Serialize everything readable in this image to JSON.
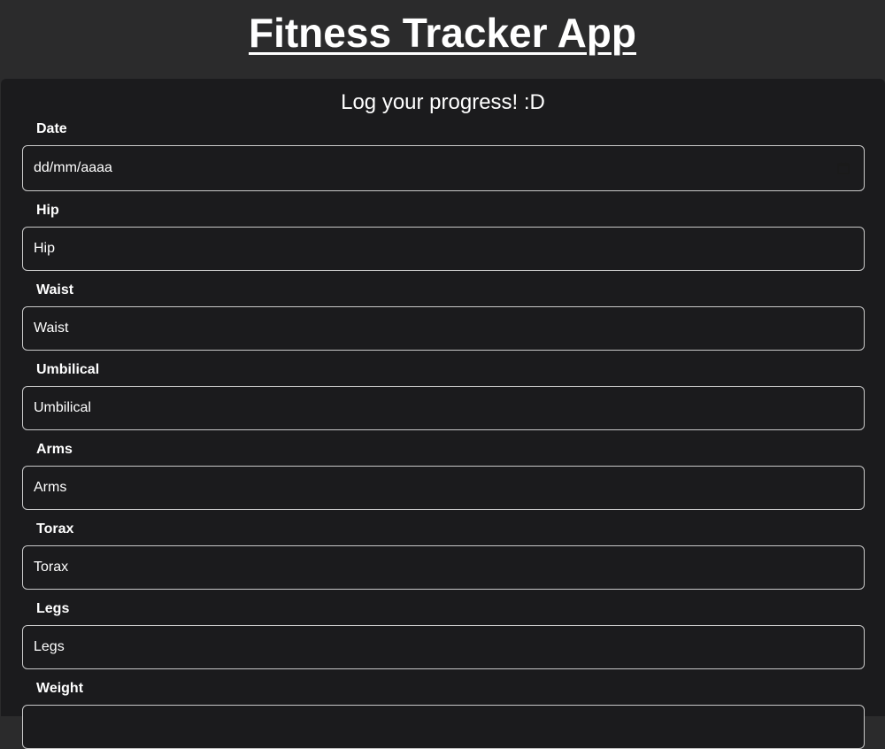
{
  "header": {
    "title": "Fitness Tracker App"
  },
  "form": {
    "heading": "Log your progress! :D",
    "fields": [
      {
        "label": "Date",
        "placeholder": "dd/mm/aaaa",
        "type": "date"
      },
      {
        "label": "Hip",
        "placeholder": "Hip",
        "type": "text"
      },
      {
        "label": "Waist",
        "placeholder": "Waist",
        "type": "text"
      },
      {
        "label": "Umbilical",
        "placeholder": "Umbilical",
        "type": "text"
      },
      {
        "label": "Arms",
        "placeholder": "Arms",
        "type": "text"
      },
      {
        "label": "Torax",
        "placeholder": "Torax",
        "type": "text"
      },
      {
        "label": "Legs",
        "placeholder": "Legs",
        "type": "text"
      },
      {
        "label": "Weight",
        "placeholder": "",
        "type": "text"
      }
    ],
    "icons": {
      "date_picker": "calendar-icon"
    }
  },
  "colors": {
    "page_background": "#2b2b2c",
    "panel_background": "#1b1b1d",
    "field_border": "#c9c9c9",
    "text": "#ffffff"
  }
}
